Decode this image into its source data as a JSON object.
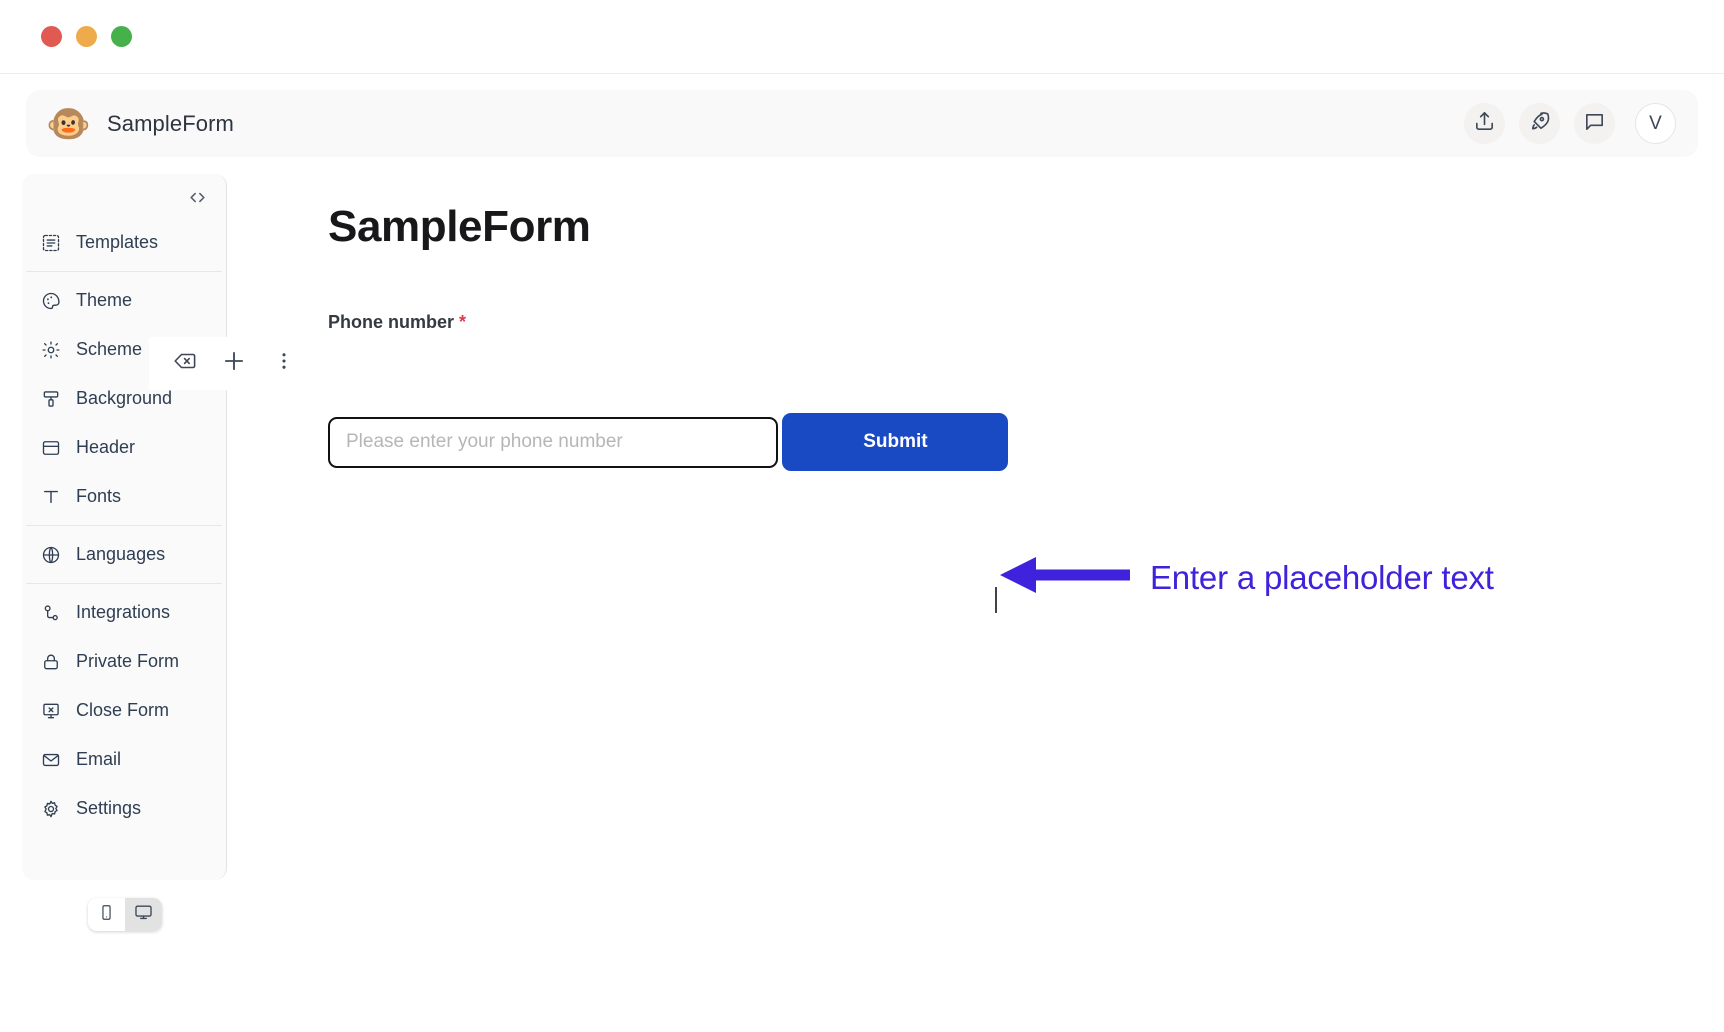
{
  "window": {
    "traffic_lights": [
      {
        "name": "close",
        "color": "#e05a52"
      },
      {
        "name": "minimize",
        "color": "#edab4b"
      },
      {
        "name": "maximize",
        "color": "#46b14a"
      }
    ]
  },
  "header": {
    "logo_glyph": "🐵",
    "logo_name": "monkey-face-icon",
    "title": "SampleForm",
    "actions": [
      {
        "name": "share-upload-icon",
        "label": "Share"
      },
      {
        "name": "rocket-icon",
        "label": "Publish"
      },
      {
        "name": "chat-bubble-icon",
        "label": "Comments"
      }
    ],
    "avatar_initial": "V"
  },
  "sidebar": {
    "code_toggle_label": "<>",
    "groups": [
      {
        "items": [
          {
            "label": "Templates",
            "icon": "templates-icon"
          }
        ]
      },
      {
        "items": [
          {
            "label": "Theme",
            "icon": "palette-icon"
          },
          {
            "label": "Scheme",
            "icon": "brightness-icon"
          },
          {
            "label": "Background",
            "icon": "paint-roller-icon"
          },
          {
            "label": "Header",
            "icon": "header-layout-icon"
          },
          {
            "label": "Fonts",
            "icon": "text-type-icon"
          }
        ]
      },
      {
        "items": [
          {
            "label": "Languages",
            "icon": "globe-icon"
          }
        ]
      },
      {
        "items": [
          {
            "label": "Integrations",
            "icon": "integrations-icon"
          },
          {
            "label": "Private Form",
            "icon": "lock-icon"
          },
          {
            "label": "Close Form",
            "icon": "close-form-icon"
          },
          {
            "label": "Email",
            "icon": "envelope-icon"
          },
          {
            "label": "Settings",
            "icon": "gear-icon"
          }
        ]
      }
    ],
    "mini_toolbar": [
      {
        "name": "backspace-delete-icon",
        "label": "Delete"
      },
      {
        "name": "plus-icon",
        "label": "Add"
      },
      {
        "name": "more-vertical-icon",
        "label": "More options"
      }
    ],
    "device_toggle": {
      "options": [
        {
          "name": "mobile-icon",
          "label": "Mobile",
          "active": false
        },
        {
          "name": "desktop-icon",
          "label": "Desktop",
          "active": true
        }
      ]
    }
  },
  "form": {
    "title": "SampleForm",
    "field": {
      "label": "Phone number",
      "required_marker": "*",
      "placeholder": "Please enter your phone number",
      "value": ""
    },
    "submit_label": "Submit"
  },
  "annotation": {
    "text": "Enter a placeholder text",
    "color": "#3f22db",
    "arrow_direction": "left"
  },
  "colors": {
    "accent_blue": "#1a49c4",
    "annotation_purple": "#3f22db",
    "required_red": "#e0394b",
    "sidebar_bg": "#fafafa",
    "header_bg": "#f9f9f9"
  }
}
